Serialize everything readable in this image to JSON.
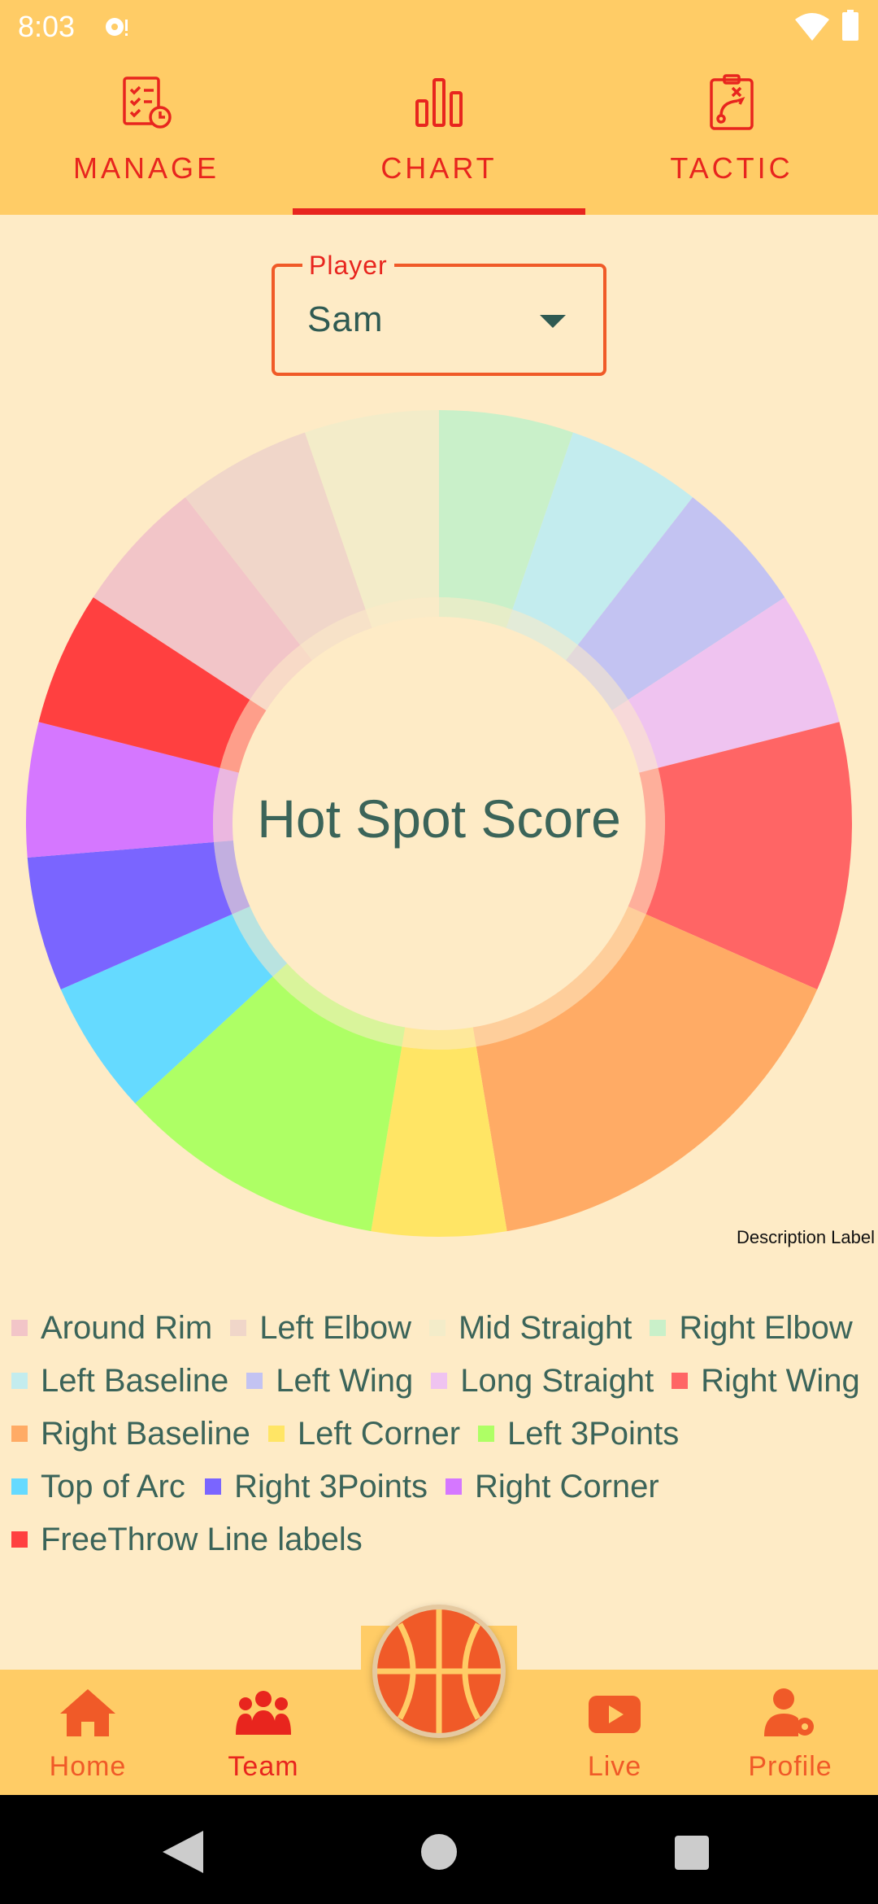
{
  "status_bar": {
    "time": "8:03",
    "icons": [
      "notification-icon",
      "wifi-icon",
      "battery-icon"
    ]
  },
  "top_tabs": [
    {
      "label": "MANAGE",
      "icon": "checklist-clock-icon",
      "active": false
    },
    {
      "label": "CHART",
      "icon": "bar-chart-icon",
      "active": true
    },
    {
      "label": "TACTIC",
      "icon": "tactic-board-icon",
      "active": false
    }
  ],
  "player_select": {
    "label": "Player",
    "value": "Sam"
  },
  "chart_data": {
    "type": "pie",
    "variant": "donut",
    "center_text": "Hot Spot Score",
    "description": "Description Label",
    "legend_placement": "bottom",
    "series": [
      {
        "name": "Around Rim",
        "value": 1,
        "color": "#F2C5C8"
      },
      {
        "name": "Left Elbow",
        "value": 1,
        "color": "#F0D6C9"
      },
      {
        "name": "Mid Straight",
        "value": 1,
        "color": "#F3ECC9"
      },
      {
        "name": "Right Elbow",
        "value": 1,
        "color": "#C9F0C9"
      },
      {
        "name": "Left Baseline",
        "value": 1,
        "color": "#C3ECEE"
      },
      {
        "name": "Left Wing",
        "value": 1,
        "color": "#C3C3F2"
      },
      {
        "name": "Long Straight",
        "value": 1,
        "color": "#EFC3F0"
      },
      {
        "name": "Right Wing",
        "value": 2,
        "color": "#FF6565"
      },
      {
        "name": "Right Baseline",
        "value": 3,
        "color": "#FFAB65"
      },
      {
        "name": "Left Corner",
        "value": 1,
        "color": "#FFE565"
      },
      {
        "name": "Left 3Points",
        "value": 2,
        "color": "#AEFF65"
      },
      {
        "name": "Top of Arc",
        "value": 1,
        "color": "#65DAFF"
      },
      {
        "name": "Right 3Points",
        "value": 1,
        "color": "#7A65FF"
      },
      {
        "name": "Right Corner",
        "value": 1,
        "color": "#D577FF"
      },
      {
        "name": "FreeThrow Line labels",
        "value": 1,
        "color": "#FF4040"
      }
    ]
  },
  "bottom_nav": [
    {
      "label": "Home",
      "icon": "home-icon",
      "active": false
    },
    {
      "label": "Team",
      "icon": "team-icon",
      "active": true
    },
    {
      "label": "Live",
      "icon": "live-icon",
      "active": false
    },
    {
      "label": "Profile",
      "icon": "profile-settings-icon",
      "active": false
    }
  ],
  "center_button": {
    "icon": "basketball-icon"
  },
  "system_nav": [
    "back-icon",
    "home-circle-icon",
    "recents-icon"
  ]
}
